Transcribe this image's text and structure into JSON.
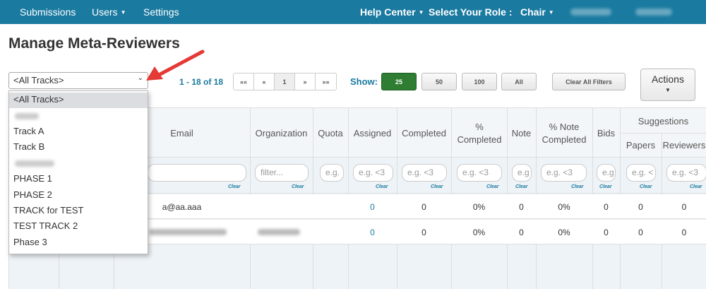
{
  "nav": {
    "submissions": "Submissions",
    "users": "Users",
    "settings": "Settings",
    "help_center": "Help Center",
    "role_label": "Select Your Role :",
    "role_value": "Chair"
  },
  "page": {
    "title": "Manage Meta-Reviewers"
  },
  "track_filter": {
    "selected": "<All Tracks>",
    "options": [
      "<All Tracks>",
      "",
      "Track A",
      "Track B",
      "",
      "PHASE 1",
      "PHASE 2",
      "TRACK for TEST",
      "TEST TRACK 2",
      "Phase 3"
    ]
  },
  "pager": {
    "info": "1 - 18 of 18",
    "first": "««",
    "prev": "«",
    "page": "1",
    "next": "»",
    "last": "»»"
  },
  "show": {
    "label": "Show:",
    "options": [
      "25",
      "50",
      "100",
      "All"
    ],
    "selected": "25"
  },
  "buttons": {
    "clear_filters": "Clear All Filters",
    "actions": "Actions"
  },
  "table": {
    "headers": {
      "email": "Email",
      "organization": "Organization",
      "quota": "Quota",
      "assigned": "Assigned",
      "completed": "Completed",
      "pct_completed": "% Completed",
      "note": "Note",
      "pct_note_completed": "% Note Completed",
      "bids": "Bids",
      "suggestions": "Suggestions",
      "papers": "Papers",
      "reviewers": "Reviewers"
    },
    "placeholders": {
      "organization": "filter...",
      "quota": "e.g.",
      "assigned": "e.g. <3",
      "completed": "e.g. <3",
      "pct_completed": "e.g. <3",
      "note": "e.g",
      "pct_note": "e.g. <3",
      "bids": "e.g",
      "papers": "e.g. <",
      "reviewers": "e.g. <3"
    },
    "clear_label": "Clear",
    "rows": [
      {
        "email": "a@aa.aaa",
        "assigned": "0",
        "completed": "0",
        "pct_completed": "0%",
        "note": "0",
        "pct_note": "0%",
        "bids": "0",
        "papers": "0",
        "reviewers": "0"
      },
      {
        "email": "",
        "assigned": "0",
        "completed": "0",
        "pct_completed": "0%",
        "note": "0",
        "pct_note": "0%",
        "bids": "0",
        "papers": "0",
        "reviewers": "0"
      }
    ]
  },
  "colors": {
    "navbar": "#1a7aa0",
    "primary_button": "#2e7d32",
    "link": "#1a7aa0",
    "arrow": "#e53935"
  }
}
